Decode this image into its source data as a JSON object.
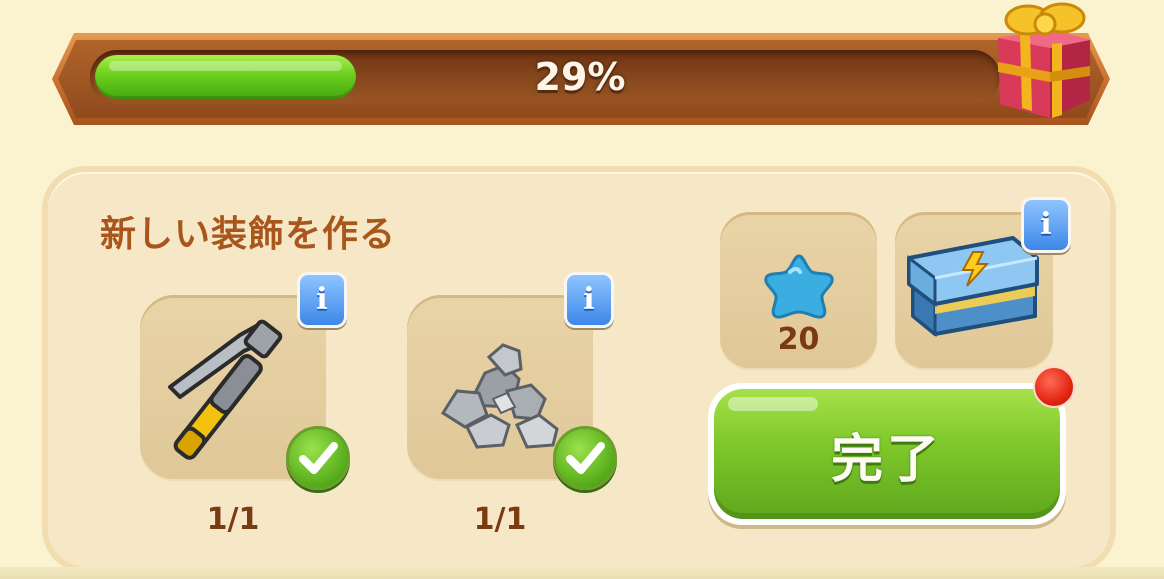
{
  "progress": {
    "percent_value": 29,
    "label": "29%"
  },
  "panel": {
    "title": "新しい装飾を作る"
  },
  "requirements": [
    {
      "item": "hammer",
      "count": "1/1",
      "icon": "hammer-icon",
      "completed": true
    },
    {
      "item": "stones",
      "count": "1/1",
      "icon": "stone-pile-icon",
      "completed": true
    }
  ],
  "rewards": [
    {
      "icon": "blue-star-icon",
      "value": "20"
    },
    {
      "icon": "energy-chest-icon"
    }
  ],
  "complete_button": {
    "label": "完了"
  },
  "colors": {
    "progress_fill": "#6ccf1e",
    "title_text": "#a9561c",
    "button_green": "#7dc62a",
    "info_blue": "#3d87e8"
  }
}
